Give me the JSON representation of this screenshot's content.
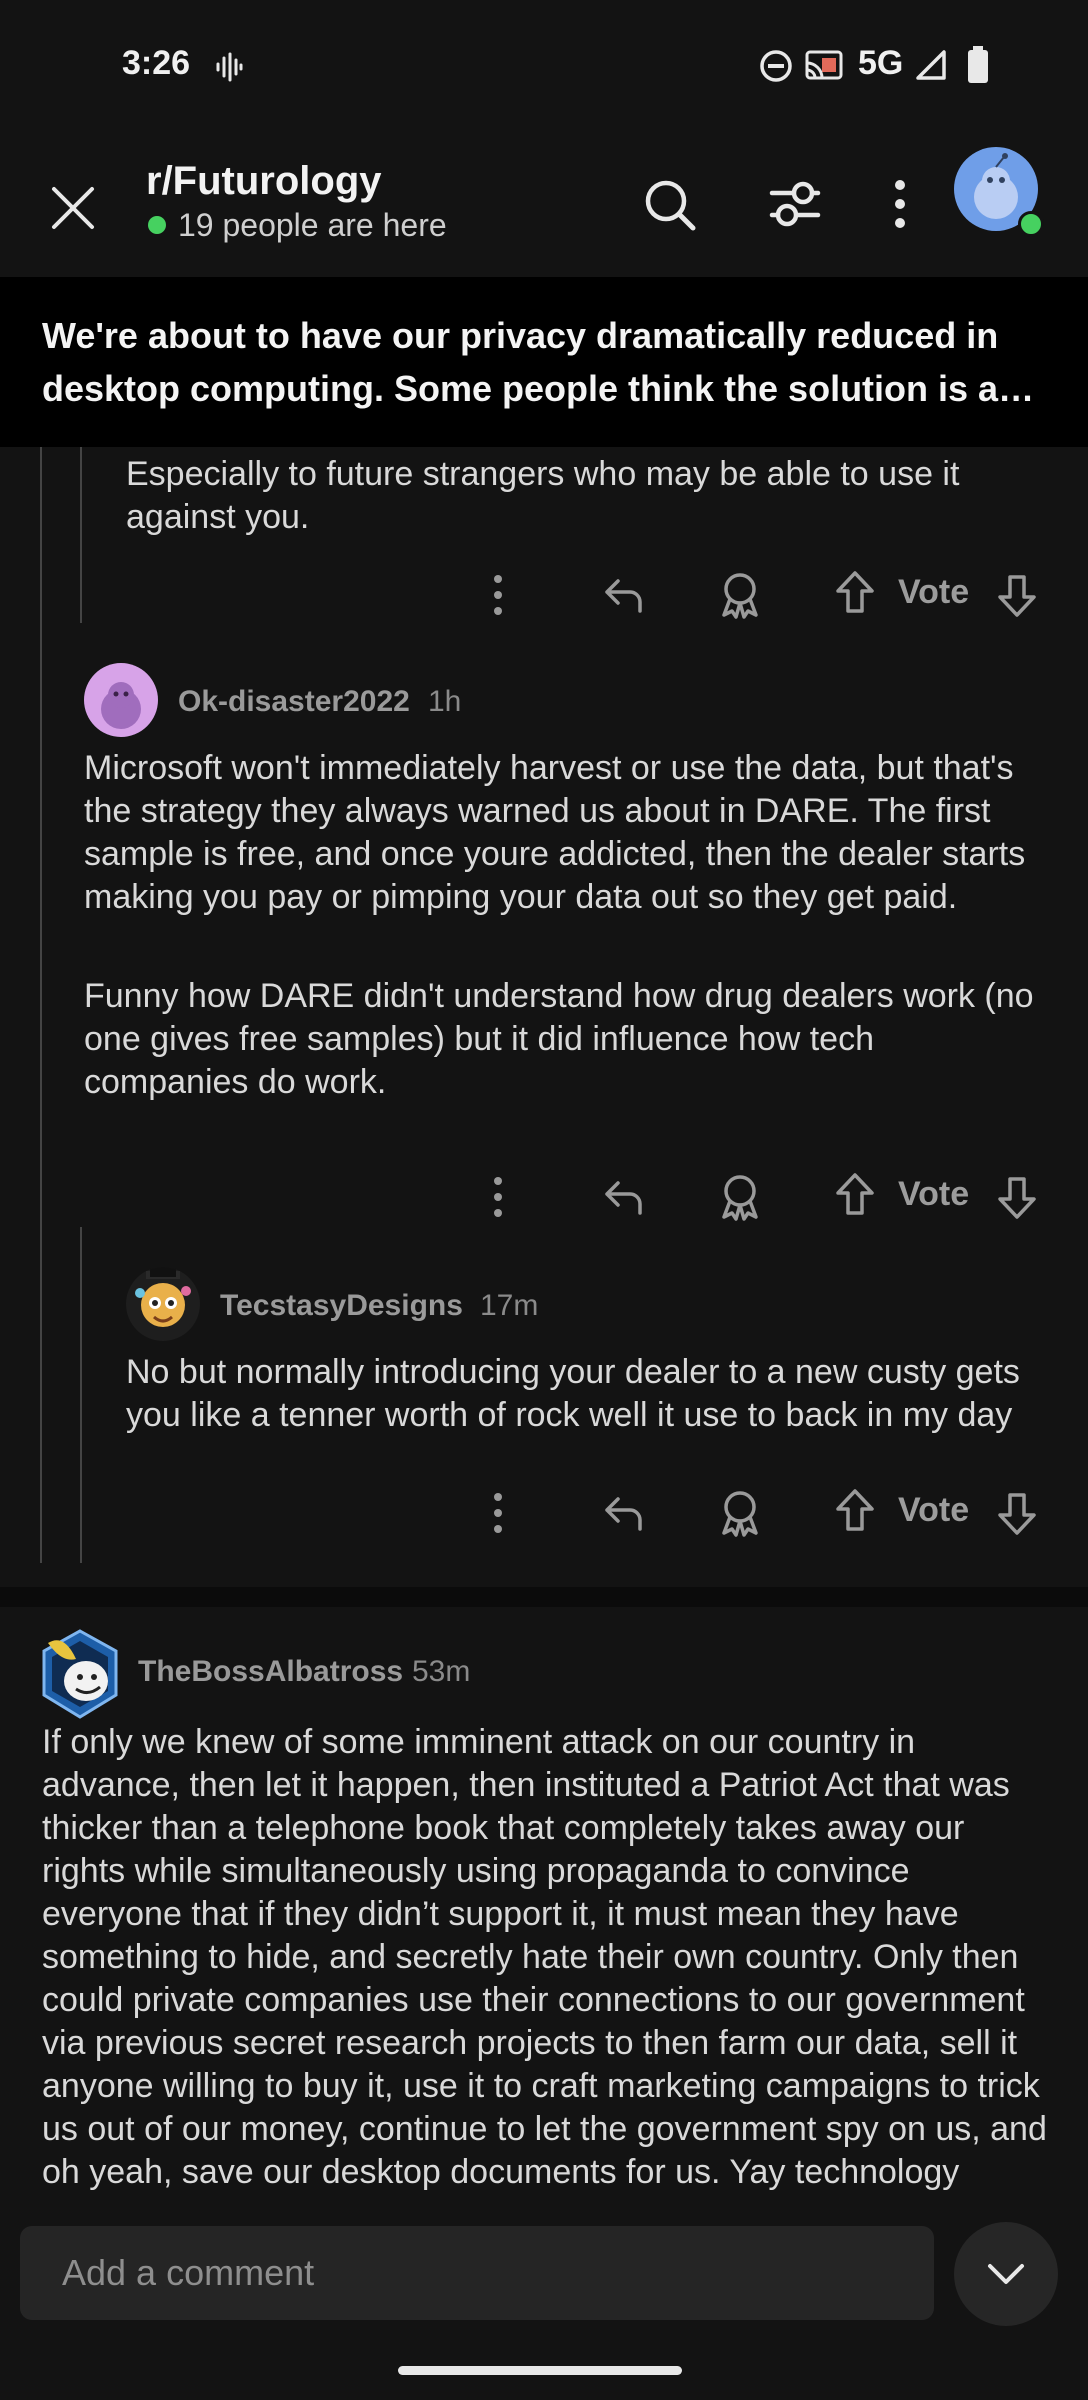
{
  "status_bar": {
    "time": "3:26",
    "network": "5G"
  },
  "header": {
    "subreddit": "r/Futurology",
    "online_text": "19 people are here"
  },
  "post": {
    "title": "We're about to have our privacy dramatically reduced in desktop computing. Some people think the solution is an open-source operating system..."
  },
  "comments": [
    {
      "id": "c1-tail",
      "body": "Especially to future strangers who may be able to use it against you."
    },
    {
      "id": "c2",
      "username": "Ok-disaster2022",
      "time": "1h",
      "paragraphs": [
        "Microsoft won't immediately harvest or use the data, but that's the strategy they always warned us about in DARE. The first sample is free, and once youre addicted, then the dealer starts making you pay or pimping your data out so they get paid.",
        "Funny how DARE didn't understand how drug dealers work (no one gives free samples) but it did influence how tech companies do work."
      ]
    },
    {
      "id": "c3",
      "username": "TecstasyDesigns",
      "time": "17m",
      "body": "No but normally introducing your dealer to a new custy gets you like a tenner worth of rock well it use to back in my day"
    },
    {
      "id": "c4",
      "username": "TheBossAlbatross",
      "time": "53m",
      "body": "If only we knew of some imminent attack on our country in advance, then let it happen, then instituted a Patriot Act that was thicker than a telephone book that completely takes away our rights while simultaneously using propaganda to convince everyone that if they didn’t support it, it must mean they have something to hide, and secretly hate their own country. Only then could private companies use their connections to our government via previous secret research projects to then farm our data, sell it anyone willing to buy it, use it to craft marketing campaigns to trick us out of our money, continue to let the government spy on us, and oh yeah, save our desktop documents for us. Yay technology"
    }
  ],
  "actions": {
    "vote_label": "Vote"
  },
  "comment_bar": {
    "placeholder": "Add a comment"
  },
  "colors": {
    "background": "#131313",
    "online": "#46d160",
    "avatar_blue": "#6f9ee8",
    "avatar_pink": "#d7a3e8"
  },
  "icons": [
    "close-icon",
    "search-icon",
    "filter-icon",
    "more-vertical-icon",
    "reply-icon",
    "award-icon",
    "upvote-icon",
    "downvote-icon",
    "chevron-down-icon"
  ]
}
